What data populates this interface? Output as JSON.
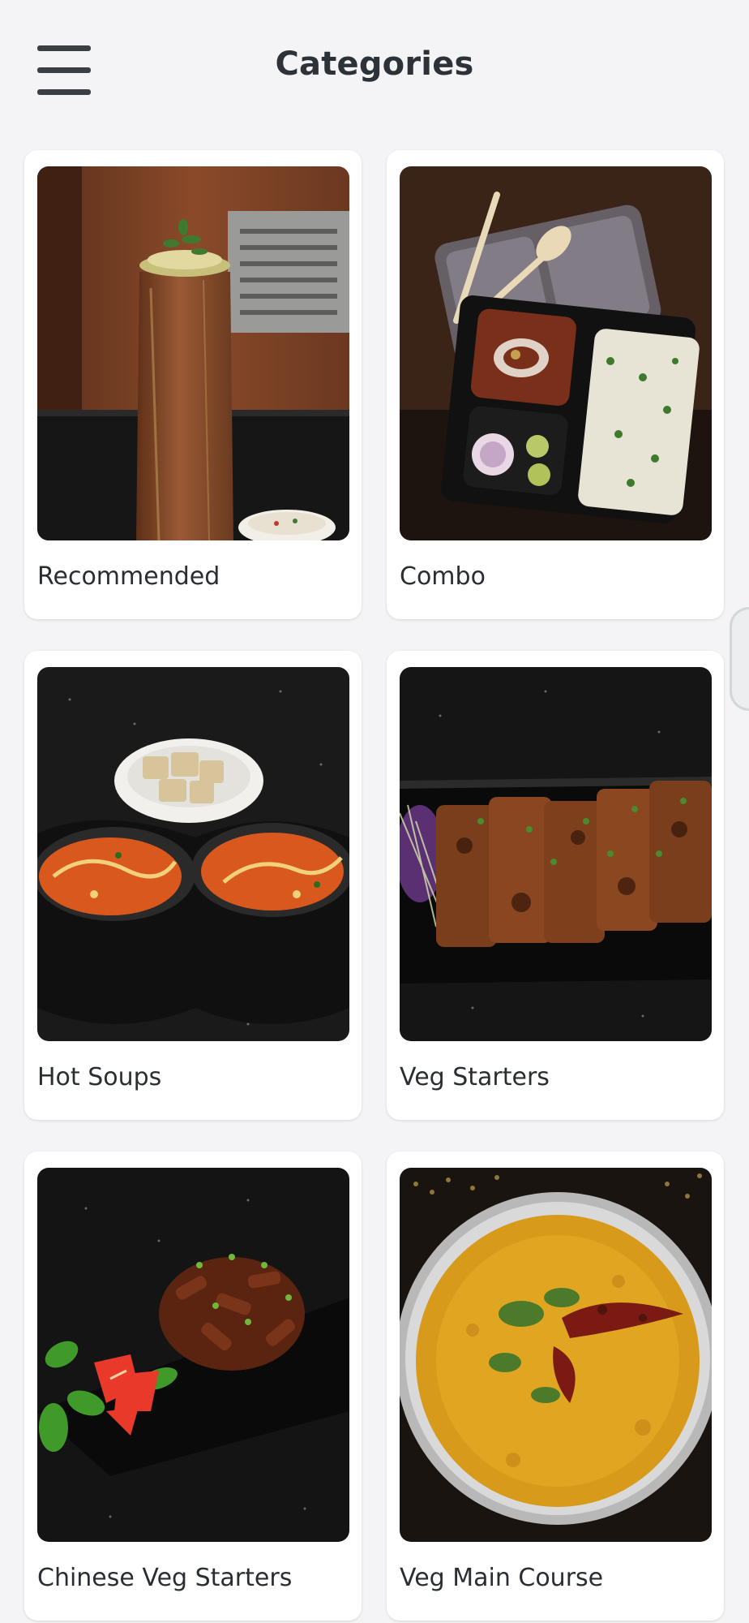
{
  "header": {
    "title": "Categories",
    "menu_icon": "hamburger-menu-icon"
  },
  "categories": [
    {
      "label": "Recommended",
      "image": "bamboo-biryani-photo"
    },
    {
      "label": "Combo",
      "image": "combo-meal-box-photo"
    },
    {
      "label": "Hot Soups",
      "image": "tomato-soup-bowls-photo"
    },
    {
      "label": "Veg Starters",
      "image": "paneer-tikka-platter-photo"
    },
    {
      "label": "Chinese Veg Starters",
      "image": "chilli-mushroom-platter-photo"
    },
    {
      "label": "Veg Main Course",
      "image": "dal-tadka-bowl-photo"
    }
  ],
  "colors": {
    "background": "#f4f4f6",
    "card": "#ffffff",
    "text": "#2a2e33",
    "menu_icon": "#3b3f44"
  }
}
